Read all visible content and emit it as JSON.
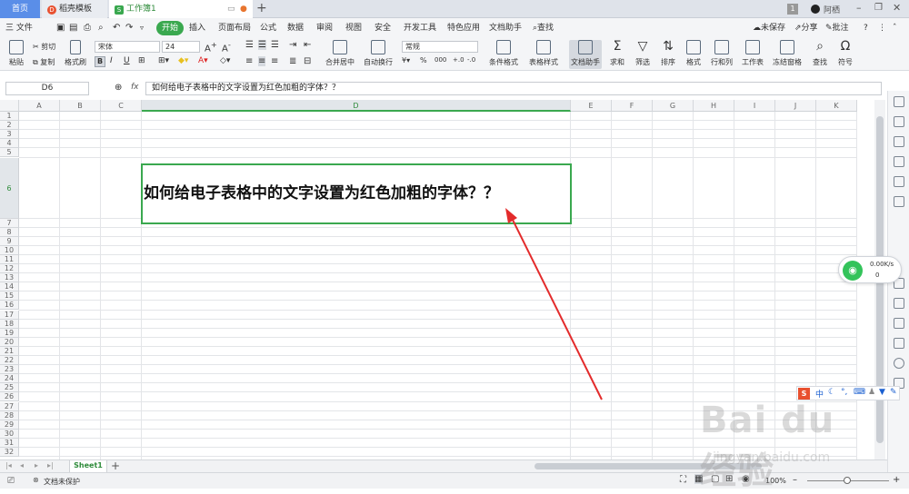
{
  "tabs": {
    "home": "首页",
    "template": "稻壳模板",
    "workbook": "工作簿1",
    "new_tab": "+"
  },
  "window": {
    "badge": "1",
    "user": "阿栖"
  },
  "menu": {
    "file": "三 文件",
    "items": [
      "开始",
      "插入",
      "页面布局",
      "公式",
      "数据",
      "审阅",
      "视图",
      "安全",
      "开发工具",
      "特色应用",
      "文档助手"
    ],
    "search": "查找",
    "unsaved": "未保存",
    "share": "分享",
    "comment": "批注"
  },
  "toolbar": {
    "paste": "粘贴",
    "cut": "剪切",
    "copy": "复制",
    "format_painter": "格式刷",
    "font_name": "宋体",
    "font_size": "24",
    "merge_center": "合并居中",
    "auto_wrap": "自动换行",
    "number_format": "常规",
    "cond_format": "条件格式",
    "table_style": "表格样式",
    "doc_helper": "文档助手",
    "sum": "求和",
    "filter": "筛选",
    "sort": "排序",
    "format": "格式",
    "row_col": "行和列",
    "worksheet": "工作表",
    "freeze": "冻结窗格",
    "find": "查找",
    "symbol": "符号"
  },
  "formula_bar": {
    "cell_ref": "D6",
    "fx": "fx",
    "content": "如何给电子表格中的文字设置为红色加粗的字体？？"
  },
  "grid": {
    "columns": [
      "A",
      "B",
      "C",
      "D",
      "E",
      "F",
      "G",
      "H",
      "I",
      "J",
      "K"
    ],
    "rows": [
      "1",
      "2",
      "3",
      "4",
      "5",
      "6",
      "7",
      "8",
      "9",
      "10",
      "11",
      "12",
      "13",
      "14",
      "15",
      "16",
      "17",
      "18",
      "19",
      "20",
      "21",
      "22",
      "23",
      "24",
      "25",
      "26",
      "27",
      "28",
      "29",
      "30",
      "31",
      "32",
      "33"
    ],
    "d6_text": "如何给电子表格中的文字设置为红色加粗的字体？？",
    "active_color": "#3aa84f",
    "arrow_color": "#e32b2b"
  },
  "sheets": [
    "Sheet1"
  ],
  "status": {
    "protect": "文档未保护",
    "zoom": "100%"
  },
  "network": {
    "speed": "0.00K/s",
    "count": "0"
  },
  "ime": "中",
  "watermark": {
    "brand": "Bai du 经验",
    "url": "jingyan.baidu.com"
  }
}
